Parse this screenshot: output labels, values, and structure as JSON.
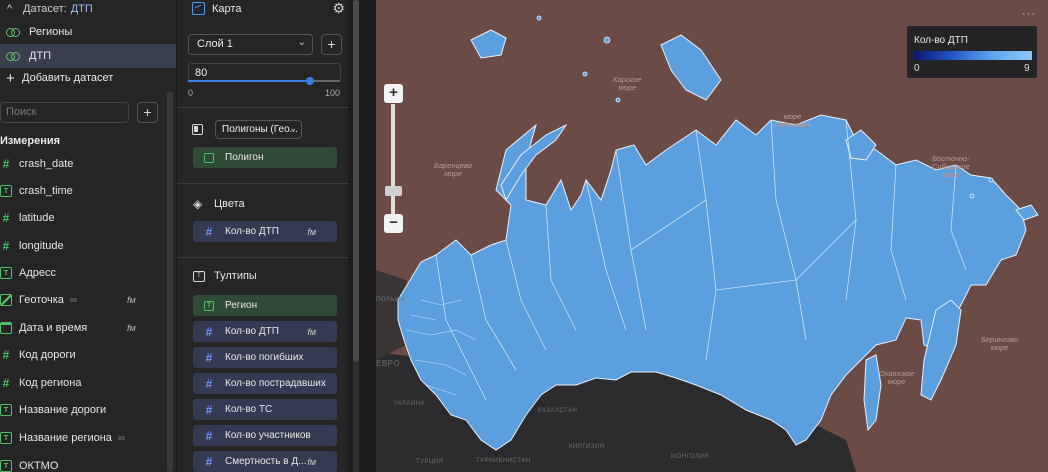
{
  "dataset_panel": {
    "header_prefix": "Датасет:",
    "header_name": "ДТП",
    "datasets": [
      "Регионы",
      "ДТП"
    ],
    "add_dataset": "Добавить датасет",
    "search_placeholder": "Поиск",
    "dimensions_title": "Измерения",
    "fields": [
      {
        "label": "crash_date",
        "type": "number"
      },
      {
        "label": "crash_time",
        "type": "text"
      },
      {
        "label": "latitude",
        "type": "number"
      },
      {
        "label": "longitude",
        "type": "number"
      },
      {
        "label": "Адресс",
        "type": "text"
      },
      {
        "label": "Геоточка",
        "type": "geo",
        "fx": "fм"
      },
      {
        "label": "Дата и время",
        "type": "datetime",
        "fx": "fм"
      },
      {
        "label": "Код дороги",
        "type": "number"
      },
      {
        "label": "Код региона",
        "type": "number"
      },
      {
        "label": "Название дороги",
        "type": "text"
      },
      {
        "label": "Название региона",
        "type": "text"
      },
      {
        "label": "ОКТМО",
        "type": "text"
      }
    ]
  },
  "map_panel": {
    "title": "Карта",
    "layer": "Слой 1",
    "opacity_value": "80",
    "opacity_fraction": 0.8,
    "slider_min": "0",
    "slider_max": "100",
    "geometry_select": "Полигоны (Гео...",
    "geometry_chip": "Полигон",
    "colors_title": "Цвета",
    "color_chip": "Кол-во ДТП",
    "color_chip_fx": "fм",
    "tooltips_title": "Тултипы",
    "tooltips": [
      {
        "label": "Регион",
        "type": "text"
      },
      {
        "label": "Кол-во ДТП",
        "type": "number",
        "fx": "fм"
      },
      {
        "label": "Кол-во погибших",
        "type": "number"
      },
      {
        "label": "Кол-во пострадавших",
        "type": "number"
      },
      {
        "label": "Кол-во ТС",
        "type": "number"
      },
      {
        "label": "Кол-во участников",
        "type": "number"
      },
      {
        "label": "Смертность в Д...",
        "type": "number",
        "fx": "fм"
      }
    ]
  },
  "map": {
    "legend_title": "Кол-во ДТП",
    "legend_min": "0",
    "legend_max": "9",
    "more_icon": "ellipsis-icon",
    "labels": {
      "kara": "Карское\nморе",
      "laptev": "море\nЛаптевых",
      "barents": "Баренцево\nморе",
      "east_siberian": "Восточно-\nСибирское\nморе",
      "bering": "Берингово\nморе",
      "okhotsk": "Охотское\nморе",
      "kazakhstan": "КАЗАХСТАН",
      "europe": "ЕВРО",
      "mongolia": "МОНГОЛИЯ",
      "turkmenistan": "ТУРКМЕНИСТАН",
      "kyrgyzstan": "КИРГИЗИЯ",
      "turkey": "ТУРЦИЯ",
      "ukraine": "УКРАИНА",
      "poland": "ПОЛЬША"
    }
  },
  "colors": {
    "region_fill": "#5b9fdf",
    "region_stroke": "#e8f0fb",
    "sea": "#6b4b46",
    "land_dark": "#2c2c2e",
    "green_chip": "#2f4a35",
    "blue_chip": "#343a52",
    "accent": "#3d7fe0"
  }
}
